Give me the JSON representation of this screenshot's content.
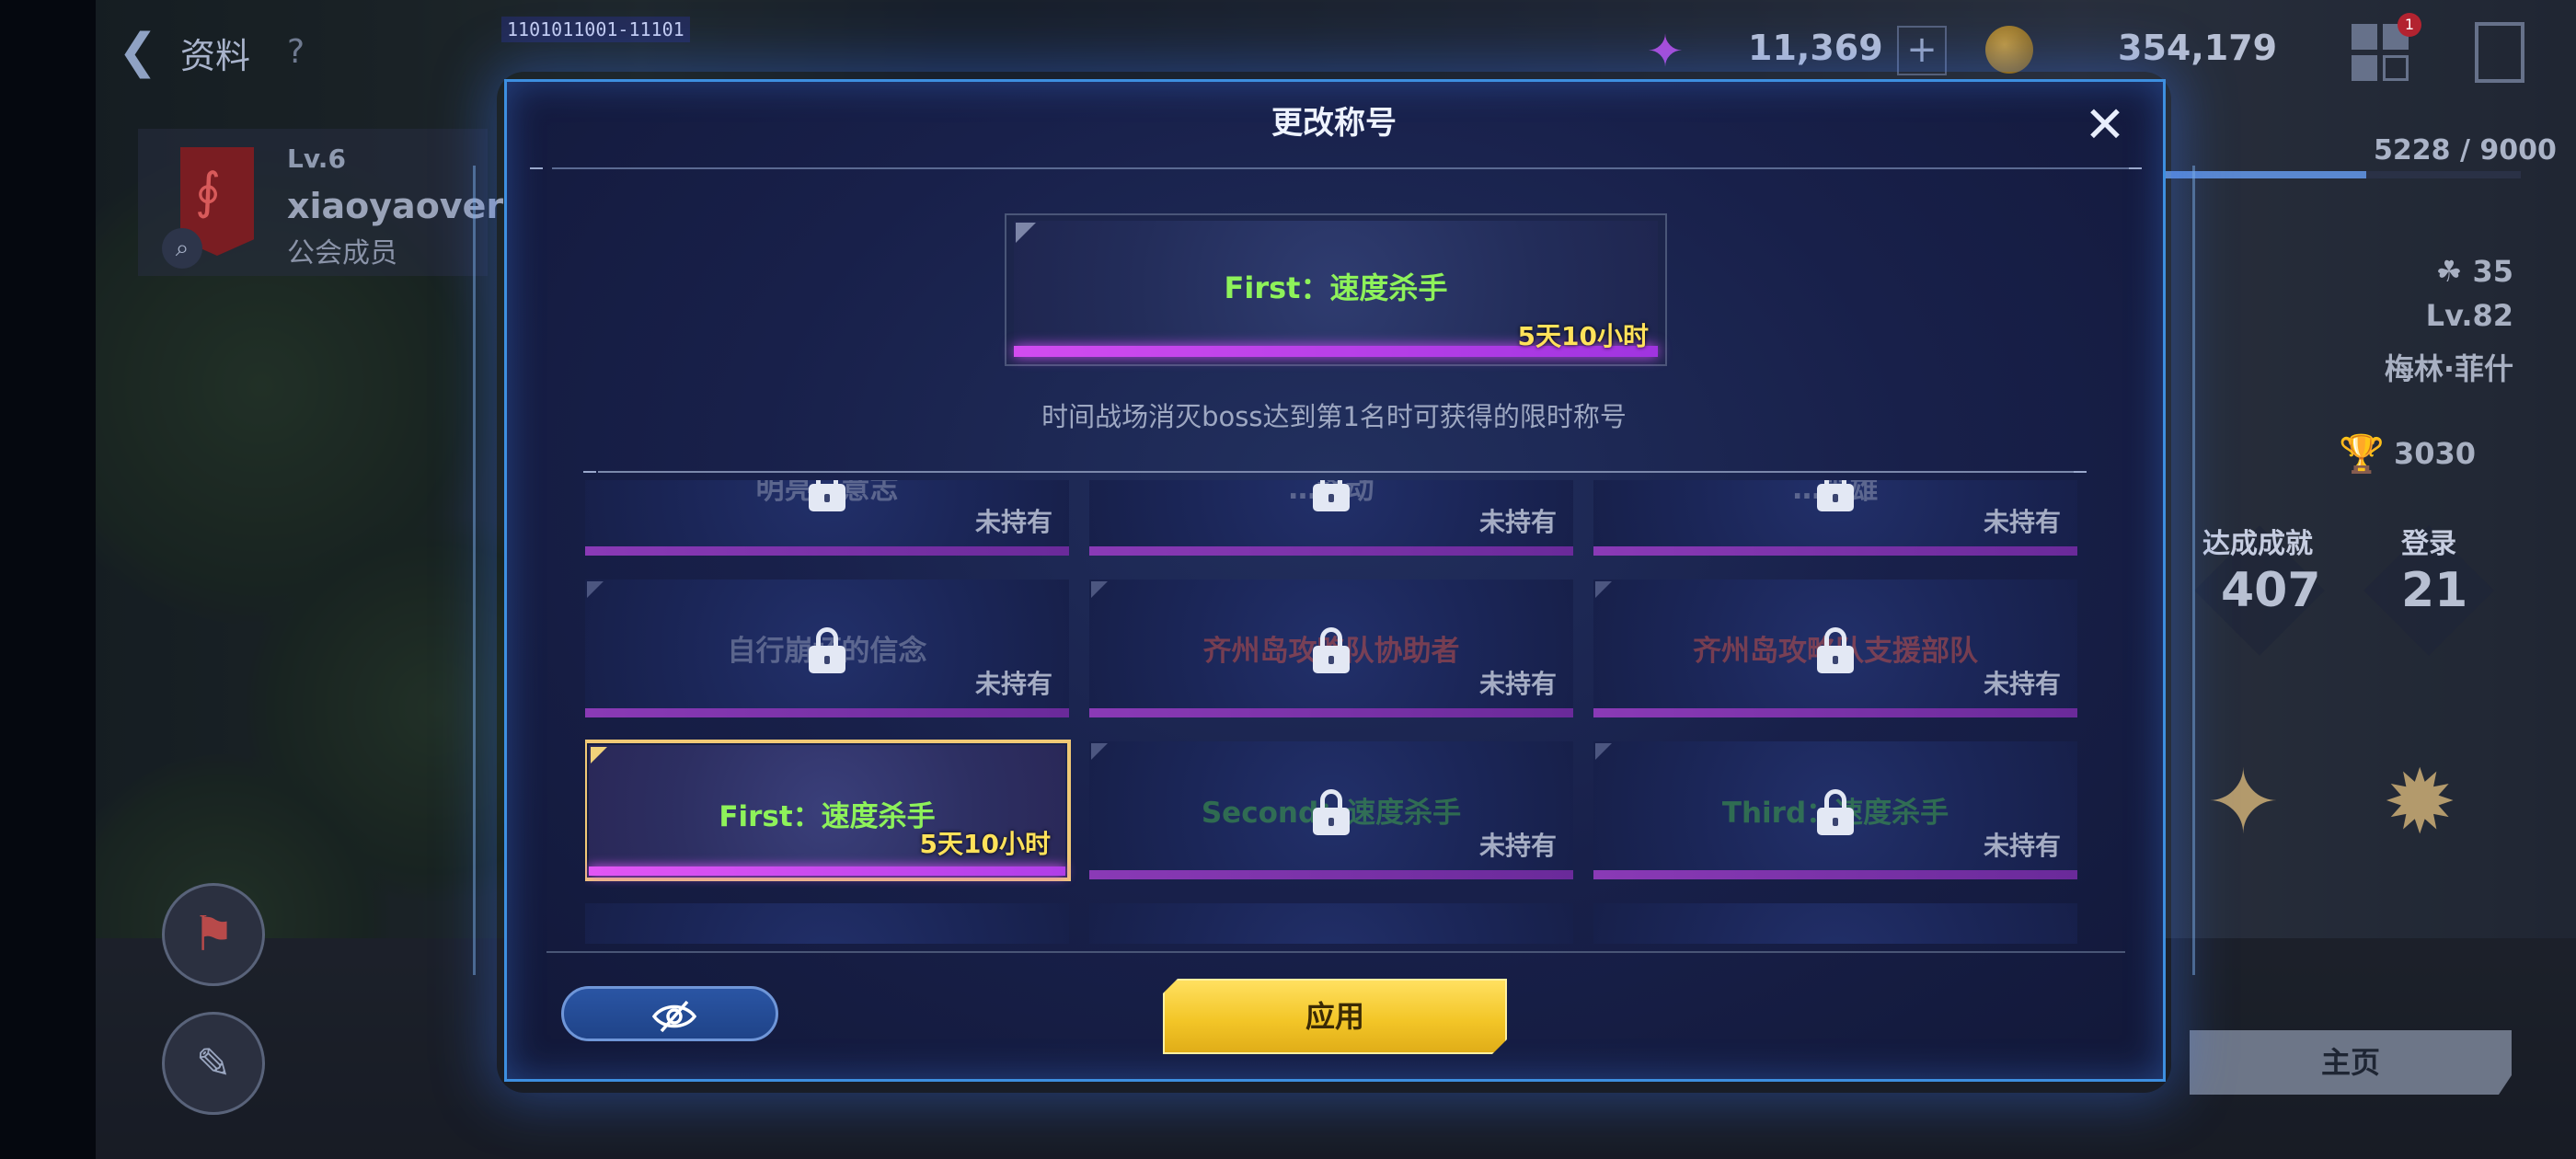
{
  "topbar": {
    "back_icon": "chevron-left-icon",
    "title": "资料",
    "help": "?",
    "id_text": "1101011001-11101",
    "gem_value": "11,369",
    "plus": "+",
    "coin_value": "354,179",
    "notification_count": "1"
  },
  "profile": {
    "level": "Lv.6",
    "name": "xiaoyaoverri",
    "guild_rank": "公会成员"
  },
  "stats": {
    "exp": "5228 / 9000",
    "exp_fraction": 0.58,
    "power": "35",
    "level": "Lv.82",
    "character": "梅林·菲什",
    "trophy": "3030",
    "achievements_label": "达成成就",
    "achievements_value": "407",
    "login_label": "登录",
    "login_value": "21",
    "home_button": "主页"
  },
  "modal": {
    "title": "更改称号",
    "close": "✕",
    "preview": {
      "name": "First：速度杀手",
      "time": "5天10小时"
    },
    "description": "时间战场消灭boss达到第1名时可获得的限时称号",
    "tiles": [
      {
        "name": "明亮…意志",
        "status": "未持有",
        "locked": true,
        "color": "#8d96b2"
      },
      {
        "name": "…移动",
        "status": "未持有",
        "locked": true,
        "color": "#8d96b2"
      },
      {
        "name": "…英雄",
        "status": "未持有",
        "locked": true,
        "color": "#8d96b2"
      },
      {
        "name": "自行崩坏的信念",
        "status": "未持有",
        "locked": true,
        "color": "#8d96b2"
      },
      {
        "name": "齐州岛攻略队协助者",
        "status": "未持有",
        "locked": true,
        "color": "#c0504a"
      },
      {
        "name": "齐州岛攻略队支援部队",
        "status": "未持有",
        "locked": true,
        "color": "#c0504a"
      },
      {
        "name": "First：速度杀手",
        "time": "5天10小时",
        "locked": false,
        "color": "#8ef25a"
      },
      {
        "name": "Second：速度杀手",
        "status": "未持有",
        "locked": true,
        "color": "#3fa34a"
      },
      {
        "name": "Third：速度杀手",
        "status": "未持有",
        "locked": true,
        "color": "#3fa34a"
      }
    ],
    "apply_button": "应用",
    "hide_icon": "eye-slash-icon"
  }
}
